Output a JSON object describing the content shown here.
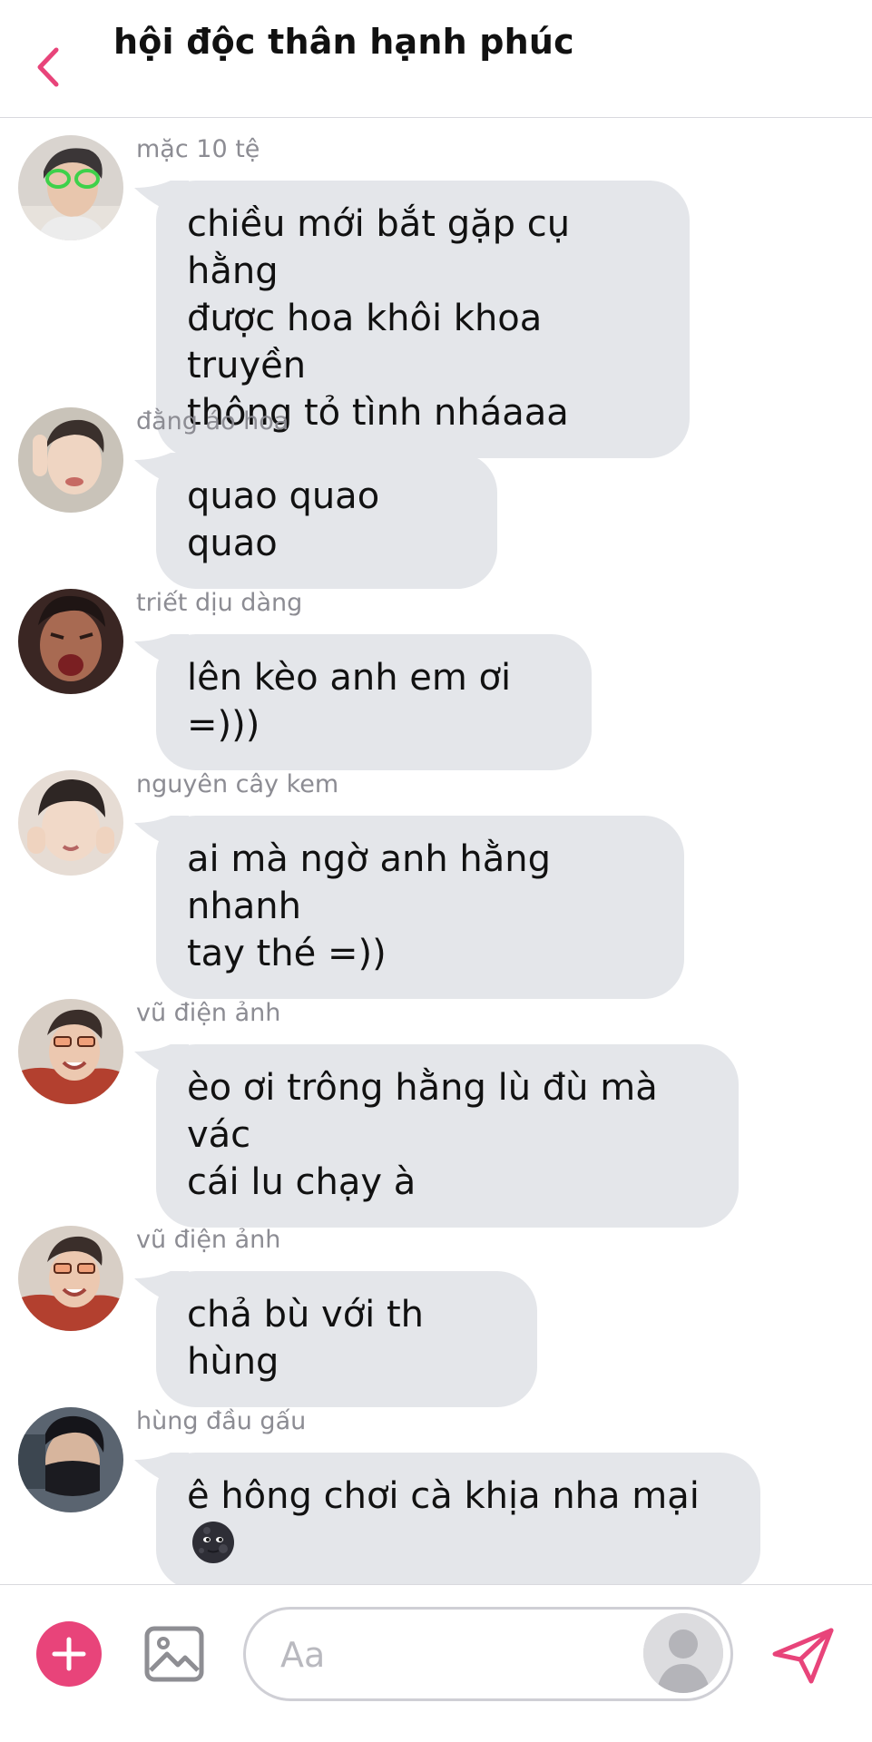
{
  "header": {
    "title": "hội độc thân hạnh phúc",
    "back_icon": "chevron-left-icon",
    "accent": "#e8447a"
  },
  "messages": [
    {
      "sender": "mặc 10 tệ",
      "text": "chiều mới bắt gặp cụ hằng\nđược hoa khôi khoa truyền\nthông tỏ tình nháaaa",
      "avatar_color": "#5b6d7a"
    },
    {
      "sender": "đằng áo hoa",
      "text": "quao quao quao",
      "avatar_color": "#a8897a"
    },
    {
      "sender": "triết dịu dàng",
      "text": "lên kèo anh em ơi =)))",
      "avatar_color": "#5a3b33"
    },
    {
      "sender": "nguyên cây kem",
      "text": "ai mà ngờ anh hằng nhanh\ntay thé =))",
      "avatar_color": "#c9a898"
    },
    {
      "sender": "vũ điện ảnh",
      "text": "èo ơi trông hằng lù đù mà vác\ncái lu chạy à",
      "avatar_color": "#b86a55"
    },
    {
      "sender": "vũ điện ảnh",
      "text": "chả bù với th hùng",
      "avatar_color": "#b86a55"
    },
    {
      "sender": "hùng đầu gấu",
      "text": "ê hông chơi cà khịa nha mại",
      "emoji": "new-moon-face-emoji",
      "avatar_color": "#2c2c34"
    }
  ],
  "composer": {
    "placeholder": "Aa",
    "plus_icon": "plus-icon",
    "gallery_icon": "image-icon",
    "send_icon": "send-icon",
    "profile_icon": "profile-icon"
  },
  "colors": {
    "bubble": "#e4e6ea",
    "sender_name": "#8c8c93",
    "accent": "#e8447a"
  }
}
